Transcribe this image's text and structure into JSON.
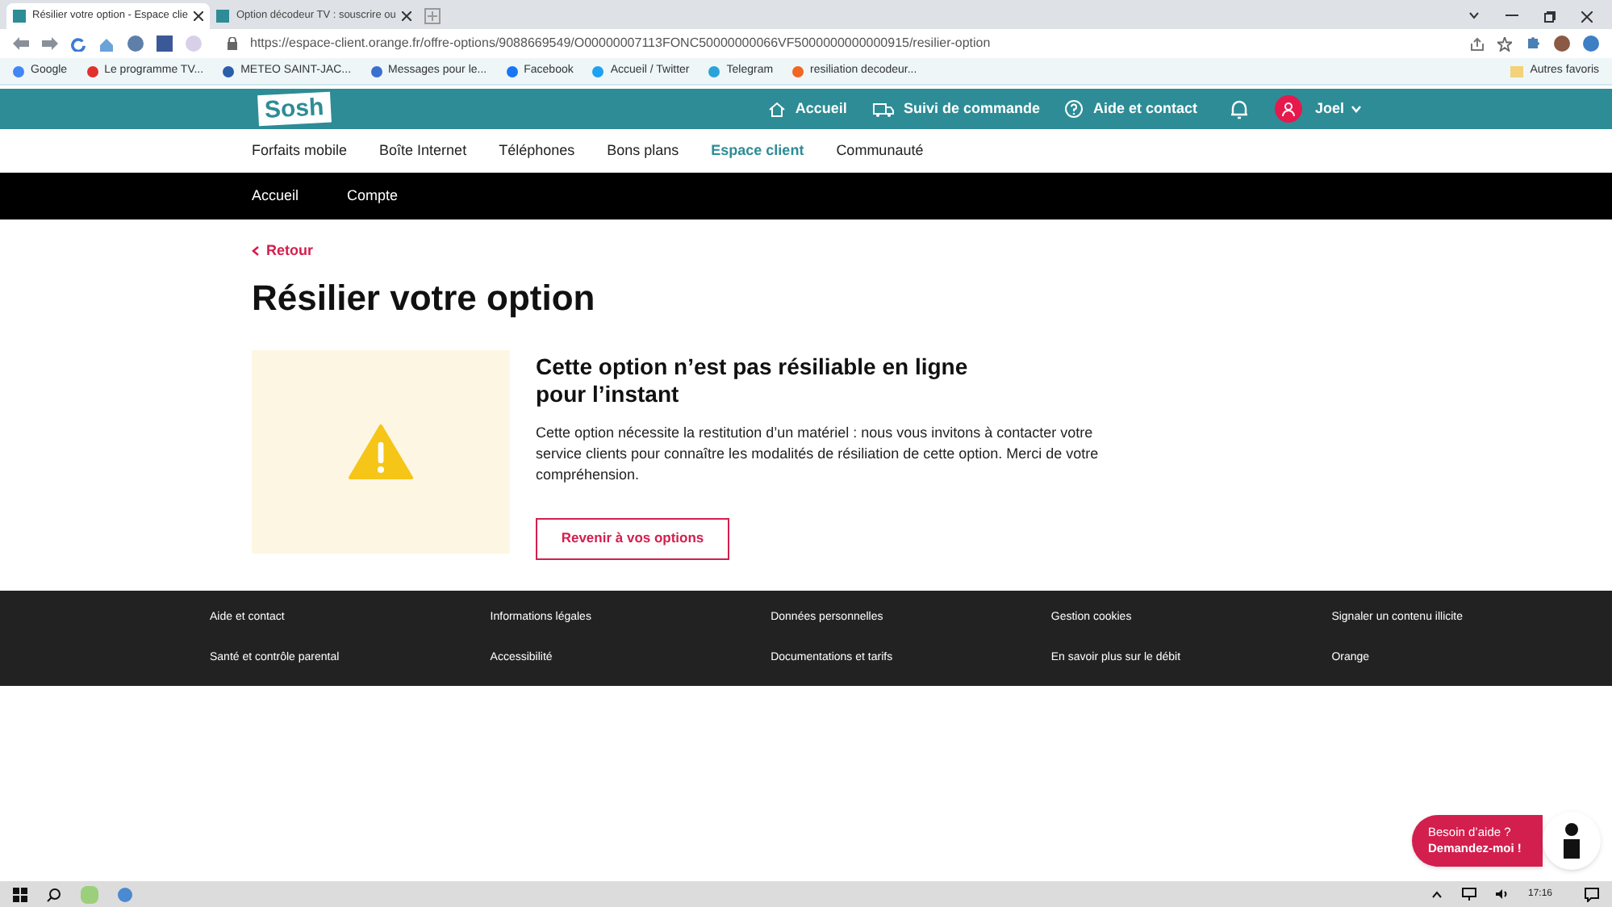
{
  "browser": {
    "tabs": [
      {
        "title": "Résilier votre option - Espace clie",
        "selected": true
      },
      {
        "title": "Option décodeur TV : souscrire ou",
        "selected": false
      }
    ],
    "url": "https://espace-client.orange.fr/offre-options/9088669549/O00000007113FONC50000000066VF5000000000000915/resilier-option",
    "bookmarks": [
      "Google",
      "Le programme TV...",
      "METEO SAINT-JAC...",
      "Messages pour le...",
      "Facebook",
      "Accueil / Twitter",
      "Telegram",
      "resiliation decodeur..."
    ],
    "other_bookmarks": "Autres favoris"
  },
  "header": {
    "logo": "Sosh",
    "links": [
      "Accueil",
      "Suivi de commande",
      "Aide et contact"
    ],
    "user": "Joel"
  },
  "nav": [
    {
      "label": "Forfaits mobile",
      "selected": false
    },
    {
      "label": "Boîte Internet",
      "selected": false
    },
    {
      "label": "Téléphones",
      "selected": false
    },
    {
      "label": "Bons plans",
      "selected": false
    },
    {
      "label": "Espace client",
      "selected": true
    },
    {
      "label": "Communauté",
      "selected": false
    }
  ],
  "subnav": [
    "Accueil",
    "Compte"
  ],
  "back_link": "Retour",
  "title": "Résilier votre option",
  "notice": {
    "heading": "Cette option n’est pas résiliable en ligne pour l’instant",
    "body": "Cette option nécessite la restitution d’un matériel : nous vous invitons à contacter votre service clients pour connaître les modalités de résiliation de cette option. Merci de votre compréhension.",
    "button": "Revenir à vos options"
  },
  "footer": [
    "Aide et contact",
    "Informations légales",
    "Données personnelles",
    "Gestion cookies",
    "Signaler un contenu illicite",
    "Santé et contrôle parental",
    "Accessibilité",
    "Documentations et tarifs",
    "En savoir plus sur le débit",
    "Orange"
  ],
  "help_bubble": {
    "line_1": "Besoin d’aide ?",
    "line_2": "Demandez-moi !"
  },
  "taskbar": {
    "time": "17:16"
  }
}
